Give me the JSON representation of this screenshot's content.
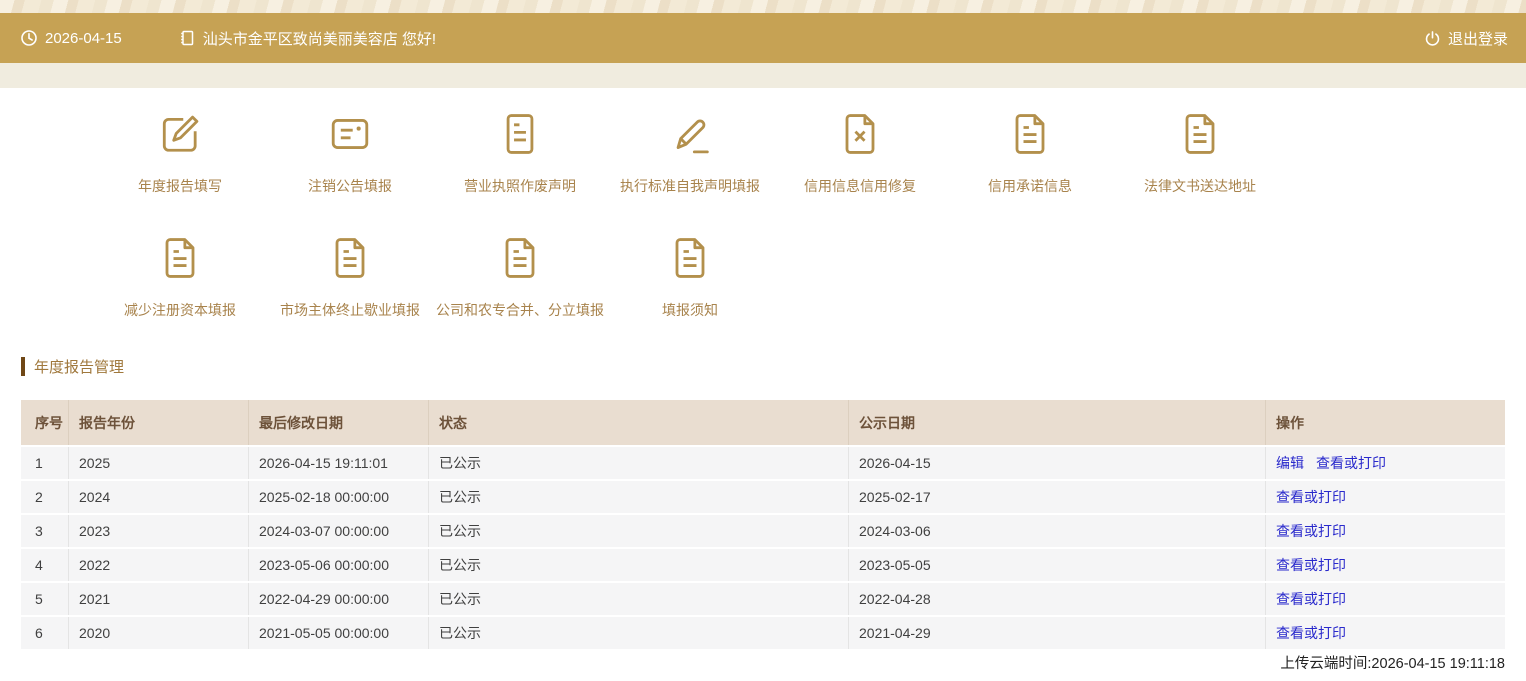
{
  "topbar": {
    "date": "2026-04-15",
    "greeting": "汕头市金平区致尚美丽美容店 您好!",
    "logout_label": "退出登录"
  },
  "icon_grid": {
    "rows": [
      [
        {
          "label": "年度报告填写",
          "icon": "edit-square-icon"
        },
        {
          "label": "注销公告填报",
          "icon": "id-card-icon"
        },
        {
          "label": "营业执照作废声明",
          "icon": "document-lines-icon"
        },
        {
          "label": "执行标准自我声明填报",
          "icon": "pencil-icon"
        },
        {
          "label": "信用信息信用修复",
          "icon": "file-x-icon"
        },
        {
          "label": "信用承诺信息",
          "icon": "file-text-icon"
        },
        {
          "label": "法律文书送达地址",
          "icon": "file-text-icon"
        }
      ],
      [
        {
          "label": "减少注册资本填报",
          "icon": "file-text-icon"
        },
        {
          "label": "市场主体终止歇业填报",
          "icon": "file-text-icon"
        },
        {
          "label": "公司和农专合并、分立填报",
          "icon": "file-text-icon"
        },
        {
          "label": "填报须知",
          "icon": "file-text-icon"
        }
      ]
    ]
  },
  "section": {
    "title": "年度报告管理"
  },
  "table": {
    "headers": [
      "序号",
      "报告年份",
      "最后修改日期",
      "状态",
      "公示日期",
      "操作"
    ],
    "rows": [
      {
        "index": "1",
        "year": "2025",
        "modified": "2026-04-15 19:11:01",
        "status": "已公示",
        "publish_date": "2026-04-15",
        "actions": [
          "编辑",
          "查看或打印"
        ]
      },
      {
        "index": "2",
        "year": "2024",
        "modified": "2025-02-18 00:00:00",
        "status": "已公示",
        "publish_date": "2025-02-17",
        "actions": [
          "查看或打印"
        ]
      },
      {
        "index": "3",
        "year": "2023",
        "modified": "2024-03-07 00:00:00",
        "status": "已公示",
        "publish_date": "2024-03-06",
        "actions": [
          "查看或打印"
        ]
      },
      {
        "index": "4",
        "year": "2022",
        "modified": "2023-05-06 00:00:00",
        "status": "已公示",
        "publish_date": "2023-05-05",
        "actions": [
          "查看或打印"
        ]
      },
      {
        "index": "5",
        "year": "2021",
        "modified": "2022-04-29 00:00:00",
        "status": "已公示",
        "publish_date": "2022-04-28",
        "actions": [
          "查看或打印"
        ]
      },
      {
        "index": "6",
        "year": "2020",
        "modified": "2021-05-05 00:00:00",
        "status": "已公示",
        "publish_date": "2021-04-29",
        "actions": [
          "查看或打印"
        ]
      }
    ]
  },
  "footer": {
    "upload_time": "上传云端时间:2026-04-15 19:11:18"
  },
  "colors": {
    "topbar_bg": "#c6a254",
    "icon_gold": "#b3904c",
    "title_accent": "#6f4716",
    "title_text": "#a0783c",
    "table_header_bg": "#e9ddd0",
    "table_header_text": "#6d523a",
    "row_bg": "#f5f5f6",
    "link_blue": "#2929cc"
  }
}
